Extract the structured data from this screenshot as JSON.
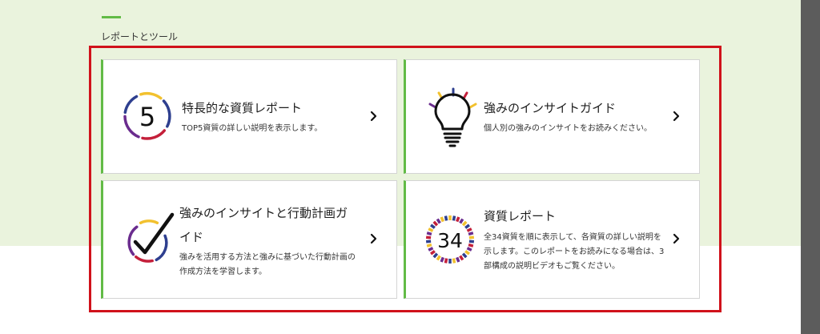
{
  "section": {
    "title": "レポートとツール"
  },
  "cards": [
    {
      "title": "特長的な資質レポート",
      "description": "TOP5資質の詳しい説明を表示します。",
      "icon_number": "5",
      "icon": "five-ring-icon"
    },
    {
      "title": "強みのインサイトガイド",
      "description": "個人別の強みのインサイトをお読みください。",
      "icon": "lightbulb-icon"
    },
    {
      "title_line1": "強みのインサイトと行動計画ガ",
      "title_line2": "イド",
      "description_line1": "強みを活用する方法と強みに基づいた行動計画の",
      "description_line2": "作成方法を学習します。",
      "icon": "checkmark-ring-icon"
    },
    {
      "title": "資質レポート",
      "description_line1": "全34資質を順に表示して、各資質の詳しい説明を",
      "description_line2": "示します。このレポートをお読みになる場合は、3",
      "description_line3": "部構成の説明ビデオもご覧ください。",
      "icon_number": "34",
      "icon": "thirty-four-ring-icon"
    }
  ],
  "colors": {
    "accent_green": "#62bb46",
    "highlight_red": "#d0121b",
    "header_background": "#eaf3dd",
    "ring_blue": "#2e3f8f",
    "ring_gold": "#f2c12e",
    "ring_purple": "#6a2c8e",
    "ring_red": "#c41f3a"
  }
}
